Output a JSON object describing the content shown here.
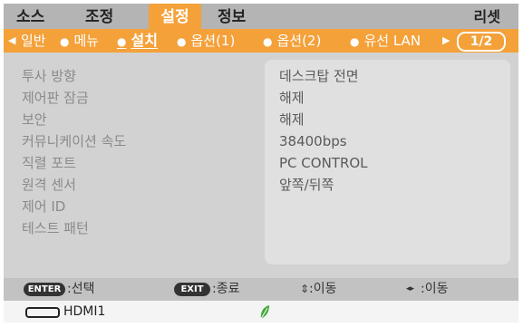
{
  "top_tabs": [
    {
      "label": "소스"
    },
    {
      "label": "조정"
    },
    {
      "label": "설정"
    },
    {
      "label": "정보"
    }
  ],
  "top_reset": "리셋",
  "sub_tabs": [
    {
      "label": "일반"
    },
    {
      "label": "메뉴"
    },
    {
      "label": "설치"
    },
    {
      "label": "옵션(1)"
    },
    {
      "label": "옵션(2)"
    },
    {
      "label": "유선 LAN"
    }
  ],
  "page_indicator": "1/2",
  "settings": [
    {
      "label": "투사 방향",
      "value": "데스크탑 전면"
    },
    {
      "label": "제어판 잠금",
      "value": "해제"
    },
    {
      "label": "보안",
      "value": "해제"
    },
    {
      "label": "커뮤니케이션 속도",
      "value": "38400bps"
    },
    {
      "label": "직렬 포트",
      "value": "PC CONTROL"
    },
    {
      "label": "원격 센서",
      "value": "앞쪽/뒤쪽"
    },
    {
      "label": "제어 ID",
      "value": ""
    },
    {
      "label": "테스트 패턴",
      "value": ""
    }
  ],
  "help": {
    "enter_key": "ENTER",
    "enter_text": ":선택",
    "exit_key": "EXIT",
    "exit_text": ":종료",
    "updown_glyph": "⇕",
    "updown_text": ":이동",
    "leftright_glyph": "◂▸",
    "leftright_text": ":이동"
  },
  "status": {
    "input_icon": "hdmi-port-icon",
    "input_name": "HDMI1",
    "eco_icon": "eco-leaf-icon"
  },
  "colors": {
    "accent": "#f4a13a",
    "eco": "#3fa83a"
  }
}
